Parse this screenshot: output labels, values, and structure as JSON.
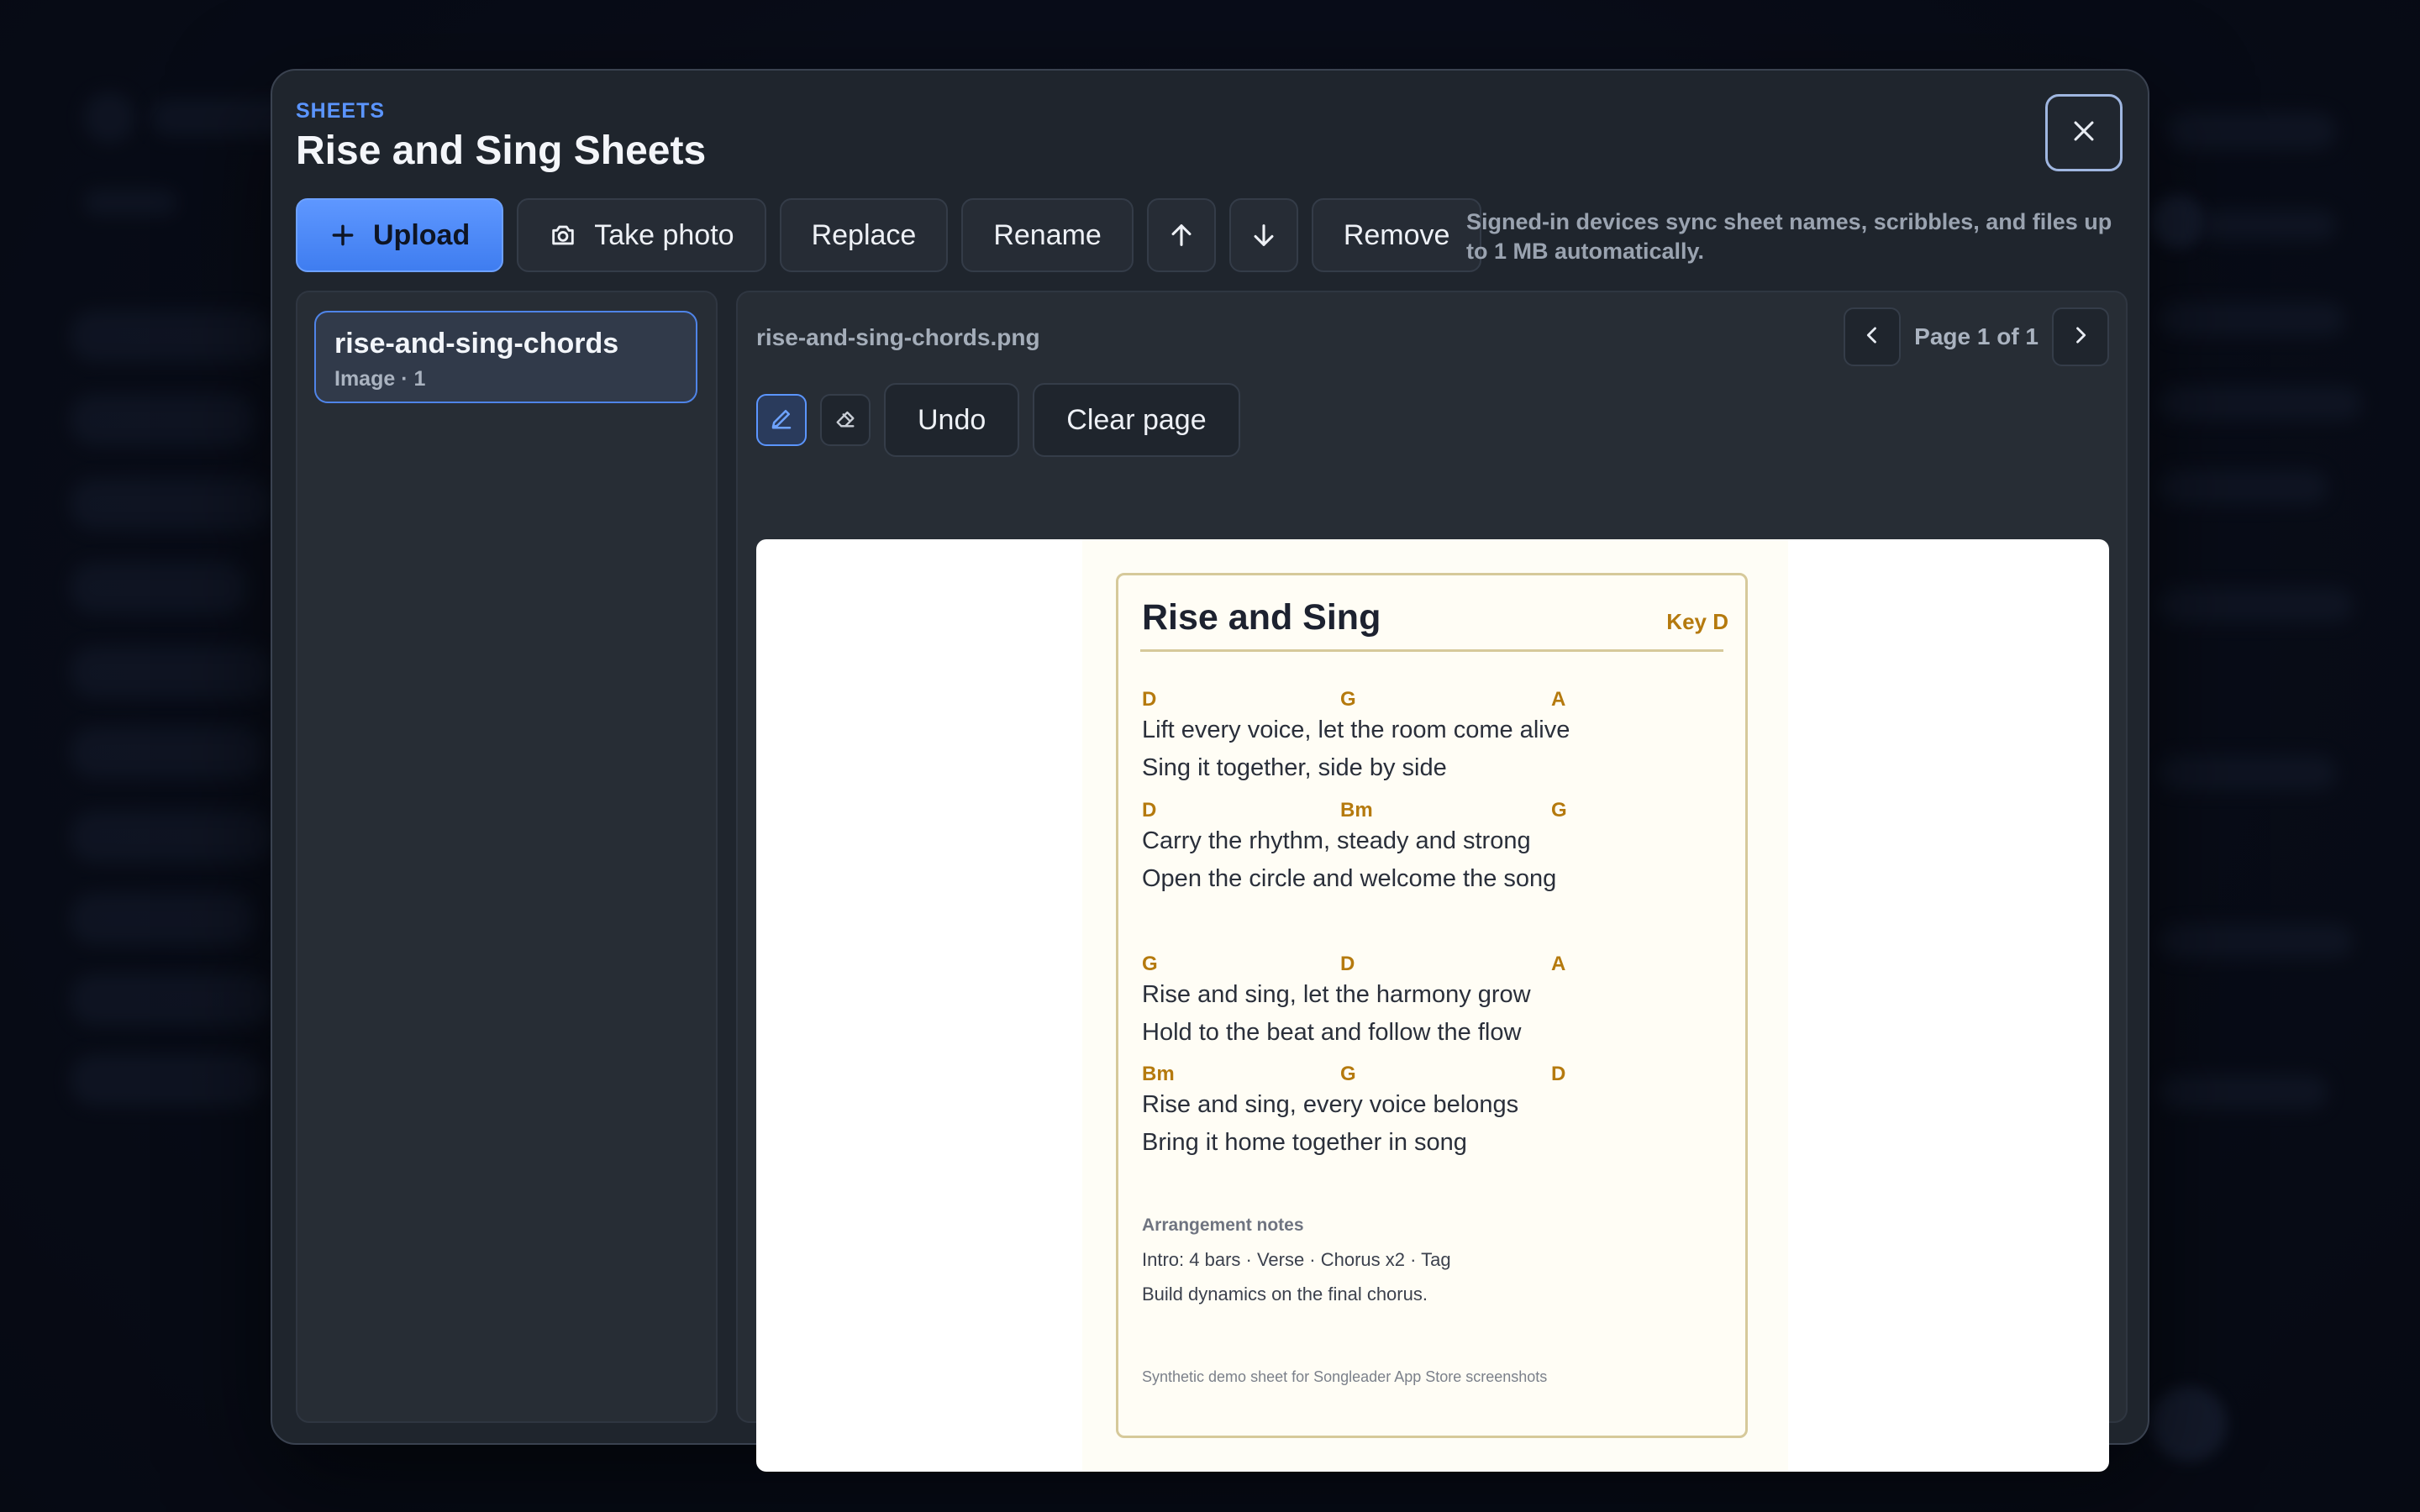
{
  "modal": {
    "eyebrow": "SHEETS",
    "title": "Rise and Sing Sheets"
  },
  "toolbar": {
    "upload_label": "Upload",
    "take_photo_label": "Take photo",
    "replace_label": "Replace",
    "rename_label": "Rename",
    "remove_label": "Remove",
    "sync_note": "Signed-in devices sync sheet names, scribbles, and files up to 1 MB automatically."
  },
  "sheets": [
    {
      "name": "rise-and-sing-chords",
      "meta": "Image · 1"
    }
  ],
  "viewer": {
    "file_name": "rise-and-sing-chords.png",
    "page_label": "Page 1 of 1",
    "undo_label": "Undo",
    "clear_label": "Clear page"
  },
  "song": {
    "title": "Rise and Sing",
    "key": "Key D",
    "lines": [
      {
        "chords": [
          "D",
          "G",
          "A"
        ],
        "lyrics": [
          "Lift every voice, let the room come alive",
          "Sing it together, side by side"
        ]
      },
      {
        "chords": [
          "D",
          "Bm",
          "G"
        ],
        "lyrics": [
          "Carry the rhythm, steady and strong",
          "Open the circle and welcome the song"
        ]
      },
      {
        "chords": [
          "G",
          "D",
          "A"
        ],
        "lyrics": [
          "Rise and sing, let the harmony grow",
          "Hold to the beat and follow the flow"
        ]
      },
      {
        "chords": [
          "Bm",
          "G",
          "D"
        ],
        "lyrics": [
          "Rise and sing, every voice belongs",
          "Bring it home together in song"
        ]
      }
    ],
    "notes_heading": "Arrangement notes",
    "notes": [
      "Intro: 4 bars · Verse · Chorus x2 · Tag",
      "Build dynamics on the final chorus."
    ],
    "footer": "Synthetic demo sheet for Songleader App Store screenshots"
  },
  "colors": {
    "accent": "#5b95ff",
    "chord": "#b57a0e",
    "modal_bg": "#1f252d"
  }
}
